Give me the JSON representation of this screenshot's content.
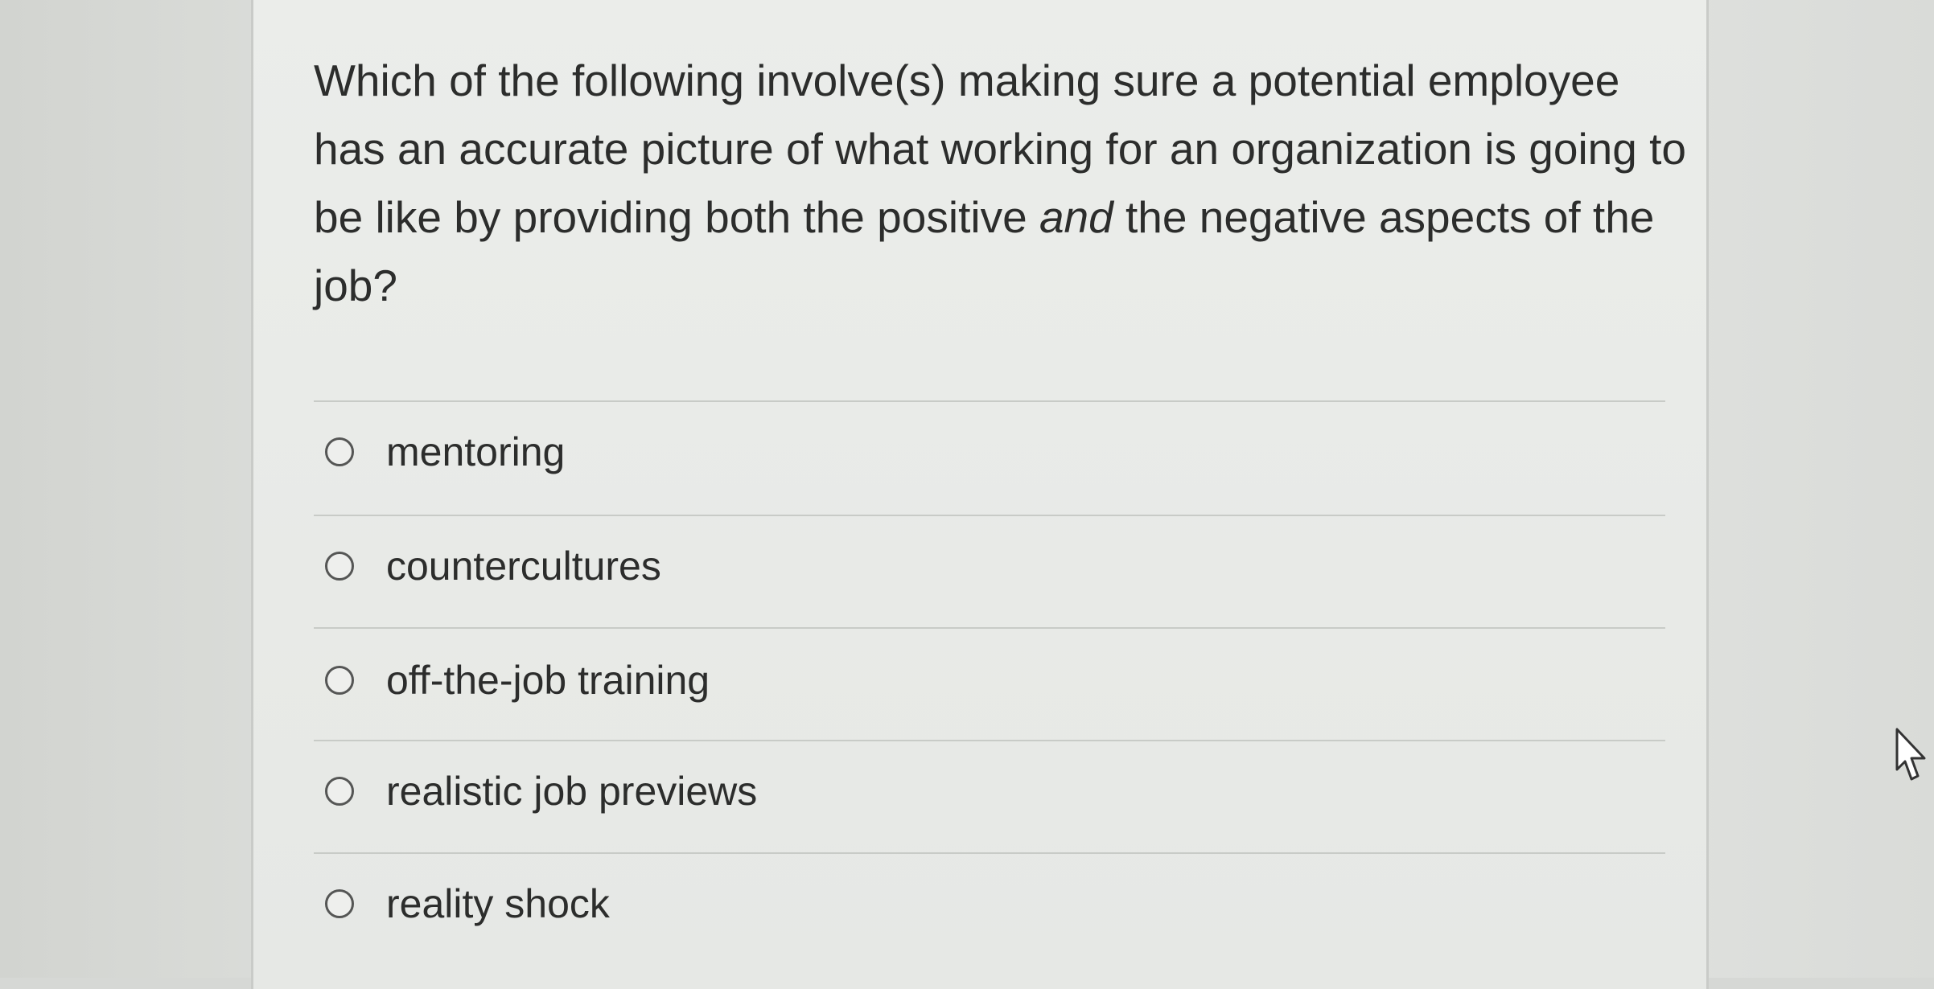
{
  "question": {
    "text_before_emphasis": "Which of the following involve(s) making sure a potential employee has an accurate picture of what working for an organization is going to be like by providing both the positive ",
    "emphasis": "and",
    "text_after_emphasis": " the negative aspects of the job?"
  },
  "options": [
    {
      "label": "mentoring",
      "selected": false
    },
    {
      "label": "countercultures",
      "selected": false
    },
    {
      "label": "off-the-job training",
      "selected": false
    },
    {
      "label": "realistic job previews",
      "selected": false
    },
    {
      "label": "reality shock",
      "selected": false
    }
  ],
  "icons": {
    "radio": "radio-button-empty",
    "cursor": "hand-pointer-cursor"
  },
  "colors": {
    "text": "#2c2d2c",
    "card_background": "#eaecea",
    "divider": "#c8cbc7",
    "radio_border": "#555655"
  }
}
